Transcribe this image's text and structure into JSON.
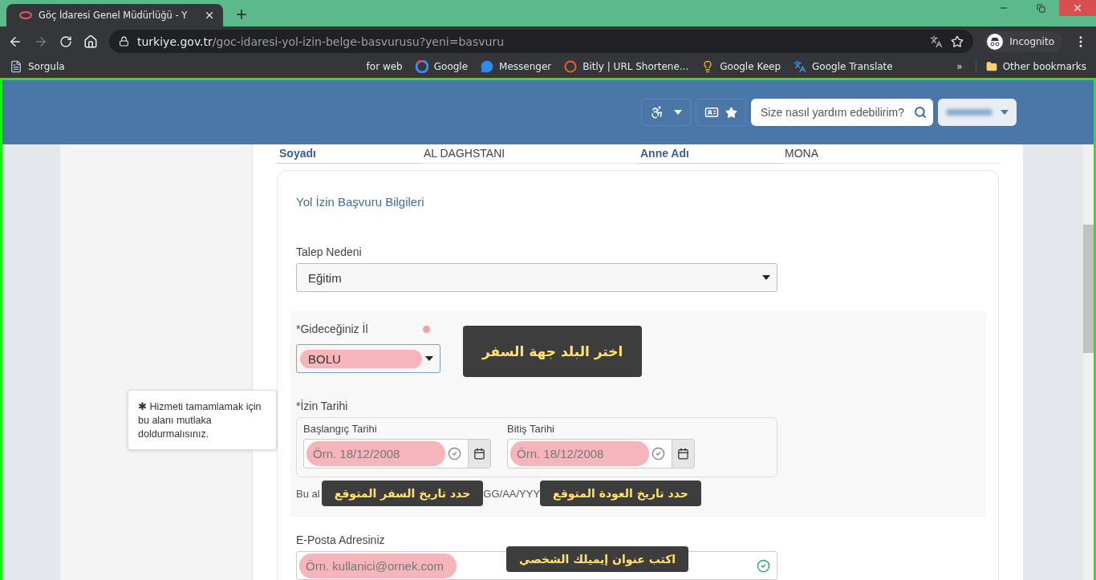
{
  "browser": {
    "tab_title": "Göç İdaresi Genel Müdürlüğü - Y",
    "url_host": "turkiye.gov.tr",
    "url_path": "/goc-idaresi-yol-izin-belge-basvurusu?yeni=basvuru",
    "profile": "Incognito",
    "bookmarks": [
      {
        "label": "Sorgula",
        "kind": "page"
      },
      {
        "label": "for web",
        "kind": "none"
      },
      {
        "label": "Google",
        "kind": "google"
      },
      {
        "label": "Messenger",
        "kind": "chat"
      },
      {
        "label": "Bitly | URL Shortene...",
        "kind": "bitly"
      },
      {
        "label": "Google Keep",
        "kind": "keep"
      },
      {
        "label": "Google Translate",
        "kind": "translate"
      }
    ],
    "more": "»",
    "other_bookmarks": "Other bookmarks"
  },
  "header": {
    "search": {
      "placeholder": "Size nasıl yardım edebilirim?"
    }
  },
  "person": [
    {
      "label": "Soyadı",
      "value": "AL DAGHSTANI"
    },
    {
      "label": "Anne Adı",
      "value": "MONA"
    }
  ],
  "form": {
    "title": "Yol İzin Başvuru Bilgileri",
    "reason": {
      "label": "Talep Nedeni",
      "value": "Eğitim"
    },
    "city": {
      "label": "*Gideceğiniz İl",
      "value": "BOLU",
      "highlighted": true,
      "annotation": "اختر البلد جهة السفر"
    },
    "date": {
      "label": "*İzin Tarihi",
      "start": {
        "label": "Başlangıç Tarihi",
        "placeholder": "Örn. 18/12/2008",
        "highlighted": true,
        "annotation": "حدد تاريخ السفر المتوقع"
      },
      "end": {
        "label": "Bitiş Tarihi",
        "placeholder": "Örn. 18/12/2008",
        "highlighted": true,
        "annotation": "حدد تاريخ العودة المتوقع"
      },
      "hint_parts": [
        "Bu al",
        "GG/AA/YYY"
      ]
    },
    "email": {
      "label": "E-Posta Adresiniz",
      "placeholder": "Örn. kullanici@ornek.com",
      "highlighted": true,
      "annotation": "اكتب عنوان إيميلك الشخصي"
    }
  },
  "tooltip": "✱ Hizmeti tamamlamak için bu alanı mutlaka doldurmalısınız."
}
